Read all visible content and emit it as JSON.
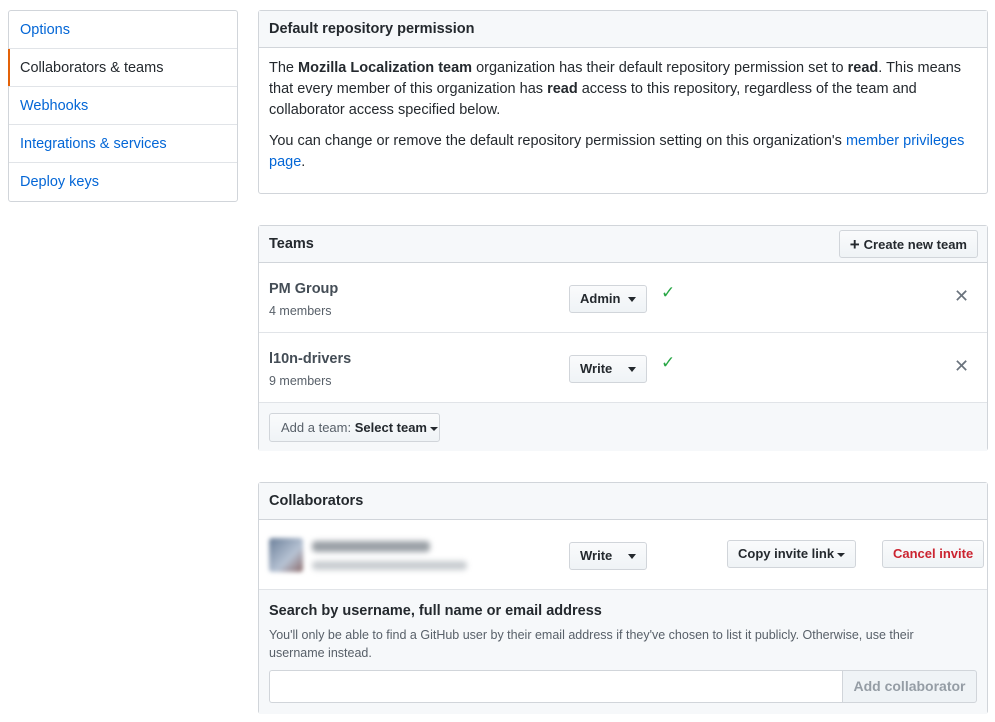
{
  "sidebar": {
    "items": [
      {
        "label": "Options"
      },
      {
        "label": "Collaborators & teams",
        "active": true
      },
      {
        "label": "Webhooks"
      },
      {
        "label": "Integrations & services"
      },
      {
        "label": "Deploy keys"
      }
    ]
  },
  "default_permission": {
    "title": "Default repository permission",
    "p1_a": "The ",
    "org_name": "Mozilla Localization team",
    "p1_b": " organization has their default repository permission set to ",
    "perm": "read",
    "p1_c": ". This means that every member of this organization has ",
    "perm2": "read",
    "p1_d": " access to this repository, regardless of the team and collaborator access specified below.",
    "p2_a": "You can change or remove the default repository permission setting on this organization's ",
    "p2_link": "member privileges page",
    "p2_b": "."
  },
  "teams": {
    "title": "Teams",
    "create_label": "Create new team",
    "rows": [
      {
        "name": "PM Group",
        "members": "4 members",
        "permission": "Admin"
      },
      {
        "name": "l10n-drivers",
        "members": "9 members",
        "permission": "Write"
      }
    ],
    "add_prefix": "Add a team:",
    "add_select": "Select team"
  },
  "collaborators": {
    "title": "Collaborators",
    "permission": "Write",
    "copy_label": "Copy invite link",
    "cancel_label": "Cancel invite",
    "search_title": "Search by username, full name or email address",
    "search_note": "You'll only be able to find a GitHub user by their email address if they've chosen to list it publicly. Otherwise, use their username instead.",
    "search_value": "",
    "add_label": "Add collaborator"
  },
  "colors": {
    "link": "#0366d6",
    "active_marker": "#e36209",
    "check": "#28a745",
    "danger": "#cb2431"
  }
}
